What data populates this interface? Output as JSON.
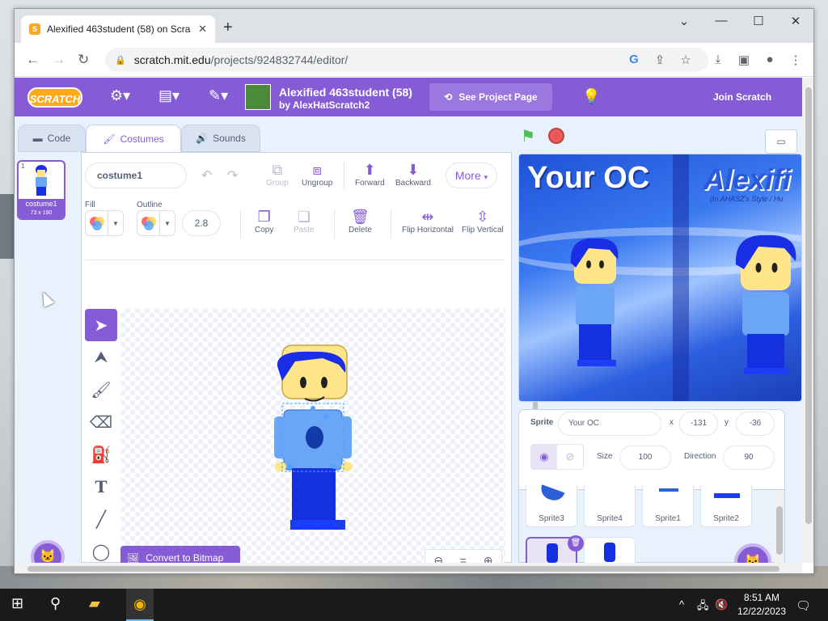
{
  "browser": {
    "tab_title": "Alexified 463student (58) on Scra",
    "url_host": "scratch.mit.edu",
    "url_path": "/projects/924832744/editor/"
  },
  "menubar": {
    "logo": "SCRATCH",
    "project_title": "Alexified 463student (58)",
    "project_by": "by AlexHatScratch2",
    "see_project_page": "See Project Page",
    "join": "Join Scratch"
  },
  "editor_tabs": {
    "code": "Code",
    "costumes": "Costumes",
    "sounds": "Sounds"
  },
  "costume": {
    "index": "1",
    "name": "costume1",
    "size": "73 x 190"
  },
  "paint": {
    "costume_name": "costume1",
    "group": "Group",
    "ungroup": "Ungroup",
    "forward": "Forward",
    "backward": "Backward",
    "more": "More",
    "fill_label": "Fill",
    "outline_label": "Outline",
    "outline_width": "2.8",
    "copy": "Copy",
    "paste": "Paste",
    "delete": "Delete",
    "flip_horizontal": "Flip Horizontal",
    "flip_vertical": "Flip Vertical",
    "convert": "Convert to Bitmap",
    "zoom_reset": "="
  },
  "stage": {
    "text_left": "Your OC",
    "text_right": "Alexifi",
    "text_sub": "(In AHASZ's Style / Hu"
  },
  "sprite_info": {
    "sprite_label": "Sprite",
    "sprite_name": "Your OC",
    "x_label": "x",
    "x_value": "-131",
    "y_label": "y",
    "y_value": "-36",
    "size_label": "Size",
    "size_value": "100",
    "direction_label": "Direction",
    "direction_value": "90"
  },
  "sprites": [
    {
      "name": "Sprite3"
    },
    {
      "name": "Sprite4"
    },
    {
      "name": "Sprite1"
    },
    {
      "name": "Sprite2"
    }
  ],
  "taskbar": {
    "time": "8:51 AM",
    "date": "12/22/2023"
  },
  "colors": {
    "scratch_purple": "#855cd6",
    "scratch_orange": "#ffab19"
  }
}
